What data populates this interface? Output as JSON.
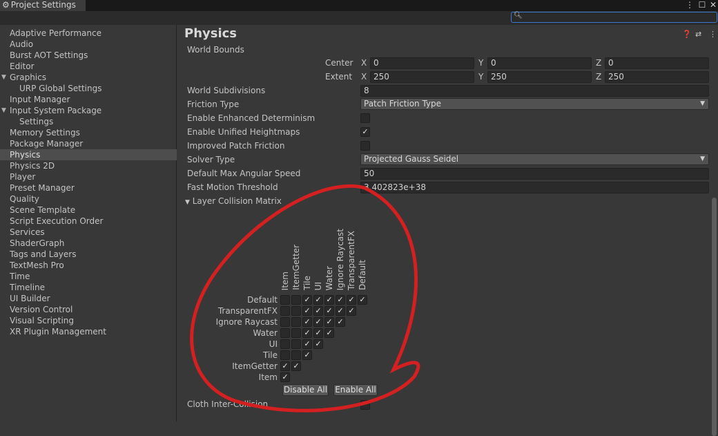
{
  "window": {
    "title": "Project Settings"
  },
  "search": {
    "value": "",
    "placeholder": ""
  },
  "sidebar": {
    "items": [
      {
        "label": "Adaptive Performance"
      },
      {
        "label": "Audio"
      },
      {
        "label": "Burst AOT Settings"
      },
      {
        "label": "Editor"
      },
      {
        "label": "Graphics",
        "expanded": true
      },
      {
        "label": "URP Global Settings",
        "child": true
      },
      {
        "label": "Input Manager"
      },
      {
        "label": "Input System Package",
        "expanded": true
      },
      {
        "label": "Settings",
        "child": true
      },
      {
        "label": "Memory Settings"
      },
      {
        "label": "Package Manager"
      },
      {
        "label": "Physics",
        "selected": true
      },
      {
        "label": "Physics 2D"
      },
      {
        "label": "Player"
      },
      {
        "label": "Preset Manager"
      },
      {
        "label": "Quality"
      },
      {
        "label": "Scene Template"
      },
      {
        "label": "Script Execution Order"
      },
      {
        "label": "Services"
      },
      {
        "label": "ShaderGraph"
      },
      {
        "label": "Tags and Layers"
      },
      {
        "label": "TextMesh Pro"
      },
      {
        "label": "Time"
      },
      {
        "label": "Timeline"
      },
      {
        "label": "UI Builder"
      },
      {
        "label": "Version Control"
      },
      {
        "label": "Visual Scripting"
      },
      {
        "label": "XR Plugin Management"
      }
    ]
  },
  "physics": {
    "title": "Physics",
    "world_bounds_label": "World Bounds",
    "center": {
      "label": "Center",
      "x": "0",
      "y": "0",
      "z": "0"
    },
    "extent": {
      "label": "Extent",
      "x": "250",
      "y": "250",
      "z": "250"
    },
    "axes": {
      "x": "X",
      "y": "Y",
      "z": "Z"
    },
    "world_subdivisions": {
      "label": "World Subdivisions",
      "value": "8"
    },
    "friction_type": {
      "label": "Friction Type",
      "value": "Patch Friction Type"
    },
    "enhanced_determinism": {
      "label": "Enable Enhanced Determinism",
      "checked": false
    },
    "unified_heightmaps": {
      "label": "Enable Unified Heightmaps",
      "checked": true
    },
    "improved_patch_friction": {
      "label": "Improved Patch Friction",
      "checked": false
    },
    "solver_type": {
      "label": "Solver Type",
      "value": "Projected Gauss Seidel"
    },
    "max_angular_speed": {
      "label": "Default Max Angular Speed",
      "value": "50"
    },
    "fast_motion_threshold": {
      "label": "Fast Motion Threshold",
      "value": "3.402823e+38"
    },
    "layer_collision_matrix_label": "Layer Collision Matrix",
    "cloth_inter_collision": {
      "label": "Cloth Inter-Collision"
    }
  },
  "matrix": {
    "layers": [
      "Default",
      "TransparentFX",
      "Ignore Raycast",
      "Water",
      "UI",
      "Tile",
      "ItemGetter",
      "Item"
    ],
    "checked": [
      [
        false,
        false,
        true,
        true,
        true,
        true,
        true,
        true
      ],
      [
        false,
        false,
        true,
        true,
        true,
        true,
        true
      ],
      [
        false,
        false,
        true,
        true,
        true,
        true
      ],
      [
        false,
        false,
        true,
        true,
        true
      ],
      [
        false,
        false,
        true,
        true
      ],
      [
        false,
        false,
        true
      ],
      [
        true,
        true
      ],
      [
        true
      ]
    ],
    "disable_all": "Disable All",
    "enable_all": "Enable All"
  },
  "colors": {
    "annotation": "#d42020",
    "accent": "#3b7bd1",
    "background": "#383838"
  },
  "icons": [
    "settings-gear-icon",
    "search-icon",
    "help-icon",
    "presets-icon",
    "more-icon"
  ]
}
